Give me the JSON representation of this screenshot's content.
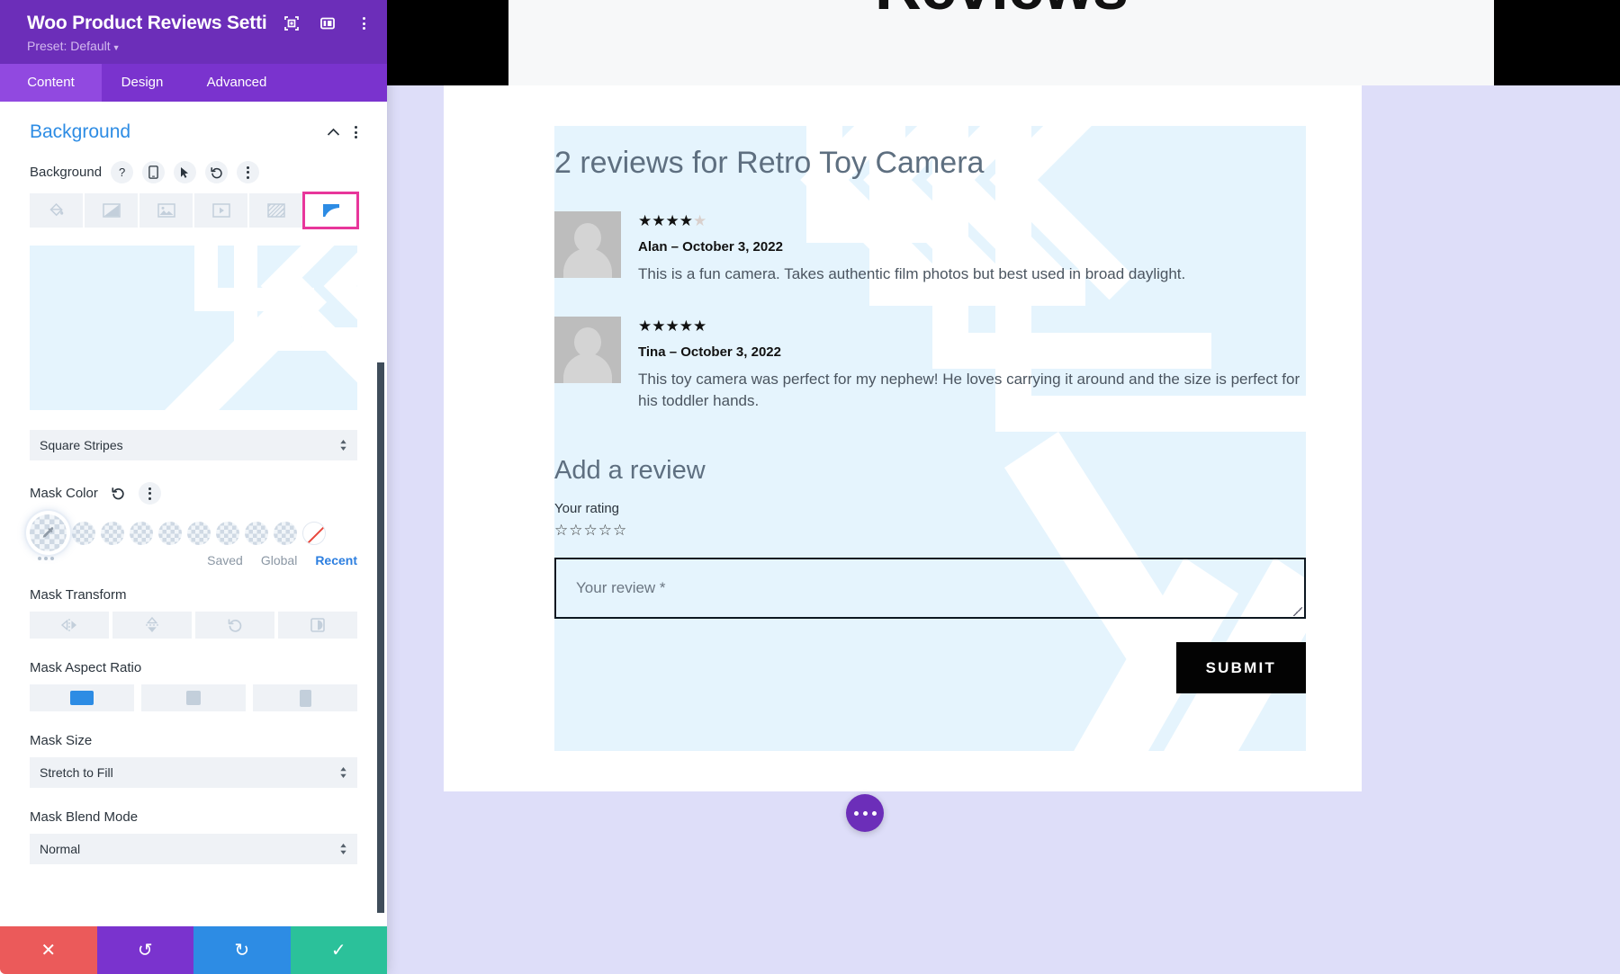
{
  "panel": {
    "title": "Woo Product Reviews Setti...",
    "preset": "Preset: Default",
    "header_icons": [
      "focus-icon",
      "layout-icon",
      "kebab-icon"
    ],
    "tabs": [
      {
        "label": "Content",
        "active": true
      },
      {
        "label": "Design",
        "active": false
      },
      {
        "label": "Advanced",
        "active": false
      }
    ],
    "section": {
      "title": "Background",
      "field_label": "Background",
      "field_icons": [
        "help-icon",
        "mobile-icon",
        "hover-icon",
        "reset-icon",
        "kebab-icon"
      ],
      "bg_types": [
        {
          "name": "color-fill-icon",
          "selected": false
        },
        {
          "name": "gradient-icon",
          "selected": false
        },
        {
          "name": "image-icon",
          "selected": false
        },
        {
          "name": "video-icon",
          "selected": false
        },
        {
          "name": "pattern-icon",
          "selected": false
        },
        {
          "name": "mask-icon",
          "selected": true
        }
      ],
      "mask_style": "Square Stripes",
      "mask_color_label": "Mask Color",
      "palette_tabs": [
        {
          "label": "Saved",
          "active": false
        },
        {
          "label": "Global",
          "active": false
        },
        {
          "label": "Recent",
          "active": true
        }
      ],
      "mask_transform_label": "Mask Transform",
      "mask_transform_buttons": [
        "flip-horizontal-icon",
        "flip-vertical-icon",
        "rotate-icon",
        "invert-icon"
      ],
      "mask_aspect_ratio_label": "Mask Aspect Ratio",
      "mask_aspect_ratios": [
        {
          "name": "landscape",
          "selected": true
        },
        {
          "name": "square",
          "selected": false
        },
        {
          "name": "portrait",
          "selected": false
        }
      ],
      "mask_size_label": "Mask Size",
      "mask_size_value": "Stretch to Fill",
      "mask_blend_mode_label": "Mask Blend Mode",
      "mask_blend_mode_value": "Normal"
    },
    "footer": [
      {
        "name": "cancel-button",
        "glyph": "✕",
        "color": "#eb5a5a"
      },
      {
        "name": "undo-button",
        "glyph": "↺",
        "color": "#7a33ce"
      },
      {
        "name": "redo-button",
        "glyph": "↻",
        "color": "#2d8ce4"
      },
      {
        "name": "save-button",
        "glyph": "✓",
        "color": "#2bc19a"
      }
    ]
  },
  "preview": {
    "hero_title": "Reviews",
    "reviews_heading": "2 reviews for Retro Toy Camera",
    "reviews": [
      {
        "author": "Alan",
        "separator": "–",
        "date": "October 3, 2022",
        "meta": "Alan – October 3, 2022",
        "rating": 4,
        "max_rating": 5,
        "text": "This is a fun camera. Takes authentic film photos but best used in broad daylight."
      },
      {
        "author": "Tina",
        "separator": "–",
        "date": "October 3, 2022",
        "meta": "Tina – October 3, 2022",
        "rating": 5,
        "max_rating": 5,
        "text": "This toy camera was perfect for my nephew! He loves carrying it around and the size is perfect for his toddler hands."
      }
    ],
    "form": {
      "title": "Add a review",
      "rating_label": "Your rating",
      "rating_value": 0,
      "rating_max": 5,
      "review_placeholder": "Your review *",
      "review_value": "",
      "submit_label": "SUBMIT"
    },
    "fab": "more-options-fab"
  },
  "colors": {
    "panel_purple": "#6c2eb9",
    "tab_purple": "#7a33ce",
    "tab_active": "#9149e0",
    "accent_blue": "#2d8ce4",
    "highlight_pink": "#e8369b",
    "mask_light_blue": "#e5f4fd",
    "page_background": "#dedef9"
  }
}
